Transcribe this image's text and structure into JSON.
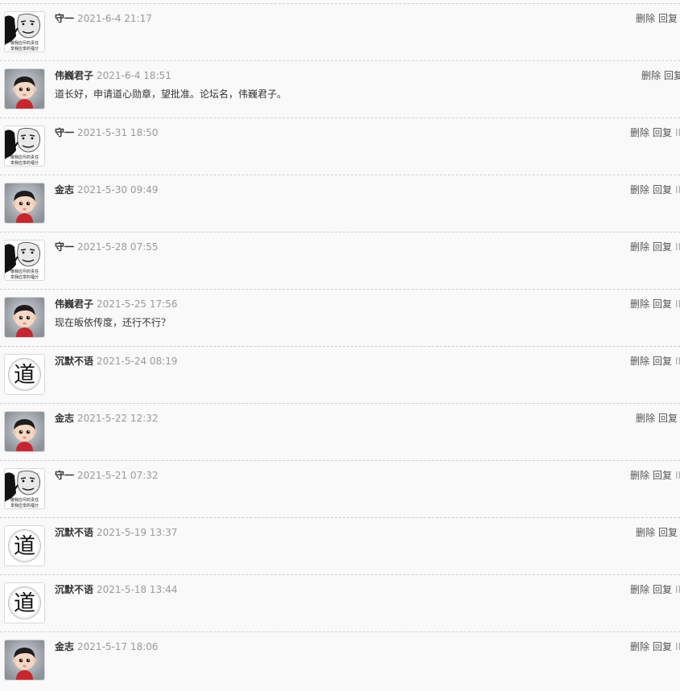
{
  "comments": [
    {
      "author": "守一",
      "time": "2021-6-4 21:17",
      "content": "",
      "avatar": "meme-face-icon",
      "delete": "删除",
      "reply": "回复",
      "ip": ""
    },
    {
      "author": "伟巍君子",
      "time": "2021-6-4 18:51",
      "content": "道长好，申请道心勋章，望批准。论坛名，伟巍君子。",
      "avatar": "cartoon-boy-icon",
      "delete": "删除",
      "reply": "回复",
      "ip": ""
    },
    {
      "author": "守一",
      "time": "2021-5-31 18:50",
      "content": "",
      "avatar": "meme-face-icon",
      "delete": "删除",
      "reply": "回复",
      "ip": "IP"
    },
    {
      "author": "金志",
      "time": "2021-5-30 09:49",
      "content": "",
      "avatar": "cartoon-boy-icon",
      "delete": "删除",
      "reply": "回复",
      "ip": "IP"
    },
    {
      "author": "守一",
      "time": "2021-5-28 07:55",
      "content": "",
      "avatar": "meme-face-icon",
      "delete": "删除",
      "reply": "回复",
      "ip": "IP"
    },
    {
      "author": "伟巍君子",
      "time": "2021-5-25 17:56",
      "content": "现在皈依传度，还行不行？",
      "avatar": "cartoon-boy-icon",
      "delete": "删除",
      "reply": "回复",
      "ip": "IP"
    },
    {
      "author": "沉默不语",
      "time": "2021-5-24 08:19",
      "content": "",
      "avatar": "dao-character-icon",
      "delete": "删除",
      "reply": "回复",
      "ip": "IP"
    },
    {
      "author": "金志",
      "time": "2021-5-22 12:32",
      "content": "",
      "avatar": "cartoon-boy-icon",
      "delete": "删除",
      "reply": "回复",
      "ip": ""
    },
    {
      "author": "守一",
      "time": "2021-5-21 07:32",
      "content": "",
      "avatar": "meme-face-icon",
      "delete": "删除",
      "reply": "回复",
      "ip": "IP"
    },
    {
      "author": "沉默不语",
      "time": "2021-5-19 13:37",
      "content": "",
      "avatar": "dao-character-icon",
      "delete": "删除",
      "reply": "回复",
      "ip": ""
    },
    {
      "author": "沉默不语",
      "time": "2021-5-18 13:44",
      "content": "",
      "avatar": "dao-character-icon",
      "delete": "删除",
      "reply": "回复",
      "ip": "IP"
    },
    {
      "author": "金志",
      "time": "2021-5-17 18:06",
      "content": "",
      "avatar": "cartoon-boy-icon",
      "delete": "删除",
      "reply": "回复",
      "ip": "IP"
    }
  ],
  "avatar_texts": {
    "meme_line1": "敬我应尽的责任",
    "meme_line2": "享我应享的福分",
    "dao_char": "道"
  },
  "colors": {
    "author": "#333333",
    "time": "#999999",
    "action": "#555555",
    "divider": "#cfcfcf",
    "background": "#f9f9f9"
  }
}
